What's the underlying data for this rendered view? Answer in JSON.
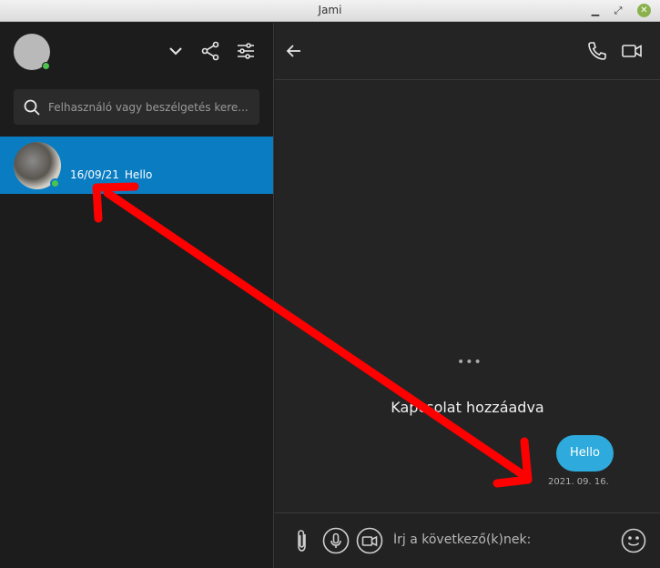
{
  "window": {
    "title": "Jami"
  },
  "sidebar": {
    "search": {
      "placeholder": "Felhasználó vagy beszélgetés kere..."
    },
    "conversations": [
      {
        "date": "16/09/21",
        "last_message": "Hello"
      }
    ]
  },
  "chat": {
    "typing_indicator": "•••",
    "system_message": "Kapcsolat hozzáadva",
    "messages": [
      {
        "text": "Hello",
        "time": "2021. 09. 16."
      }
    ],
    "composer": {
      "placeholder": "Írj a következő(k)nek:"
    }
  },
  "colors": {
    "accent": "#0a7dc2",
    "bubble": "#2eaadc",
    "presence": "#4ec14e",
    "annotation": "#ff0000"
  },
  "icons": {
    "dropdown": "chevron-down-icon",
    "share": "share-icon",
    "settings": "sliders-icon",
    "search": "search-icon",
    "back": "arrow-left-icon",
    "call": "phone-icon",
    "video": "video-camera-icon",
    "attach": "paperclip-icon",
    "audio": "microphone-icon",
    "video_message": "video-message-icon",
    "emoji": "emoji-icon"
  }
}
